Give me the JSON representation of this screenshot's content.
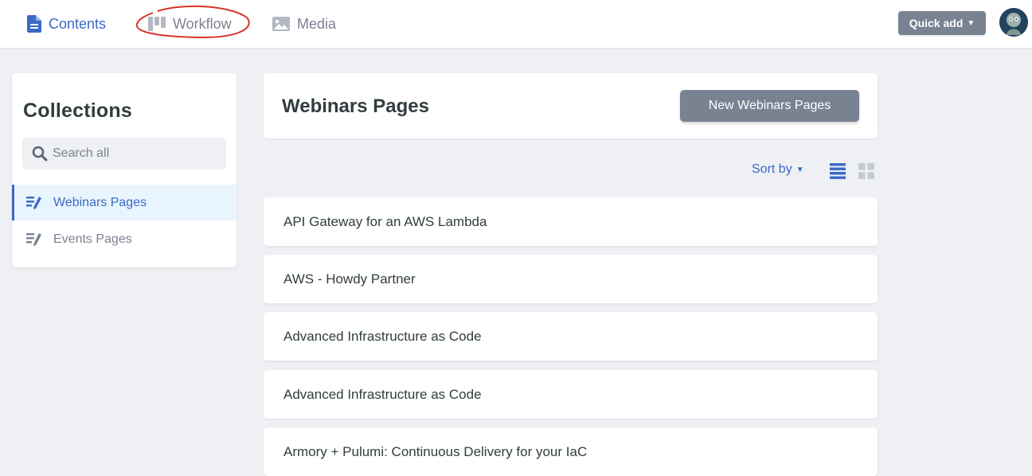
{
  "nav": {
    "contents_label": "Contents",
    "workflow_label": "Workflow",
    "media_label": "Media",
    "active": "contents"
  },
  "header": {
    "quick_add_label": "Quick add",
    "quick_add_caret": "▼"
  },
  "sidebar": {
    "title": "Collections",
    "search_placeholder": "Search all",
    "items": [
      {
        "label": "Webinars Pages",
        "active": true
      },
      {
        "label": "Events Pages",
        "active": false
      }
    ]
  },
  "main": {
    "title": "Webinars Pages",
    "new_button_label": "New Webinars Pages",
    "sort_label": "Sort by",
    "sort_caret": "▼",
    "entries": [
      {
        "title": "API Gateway for an AWS Lambda"
      },
      {
        "title": "AWS - Howdy Partner"
      },
      {
        "title": "Advanced Infrastructure as Code"
      },
      {
        "title": "Advanced Infrastructure as Code"
      },
      {
        "title": "Armory + Pulumi: Continuous Delivery for your IaC"
      }
    ]
  },
  "colors": {
    "accent": "#3a69c7",
    "muted": "#7b8290",
    "button_bg": "#798291",
    "page_bg": "#eff0f4",
    "annotation": "#d9342b"
  }
}
